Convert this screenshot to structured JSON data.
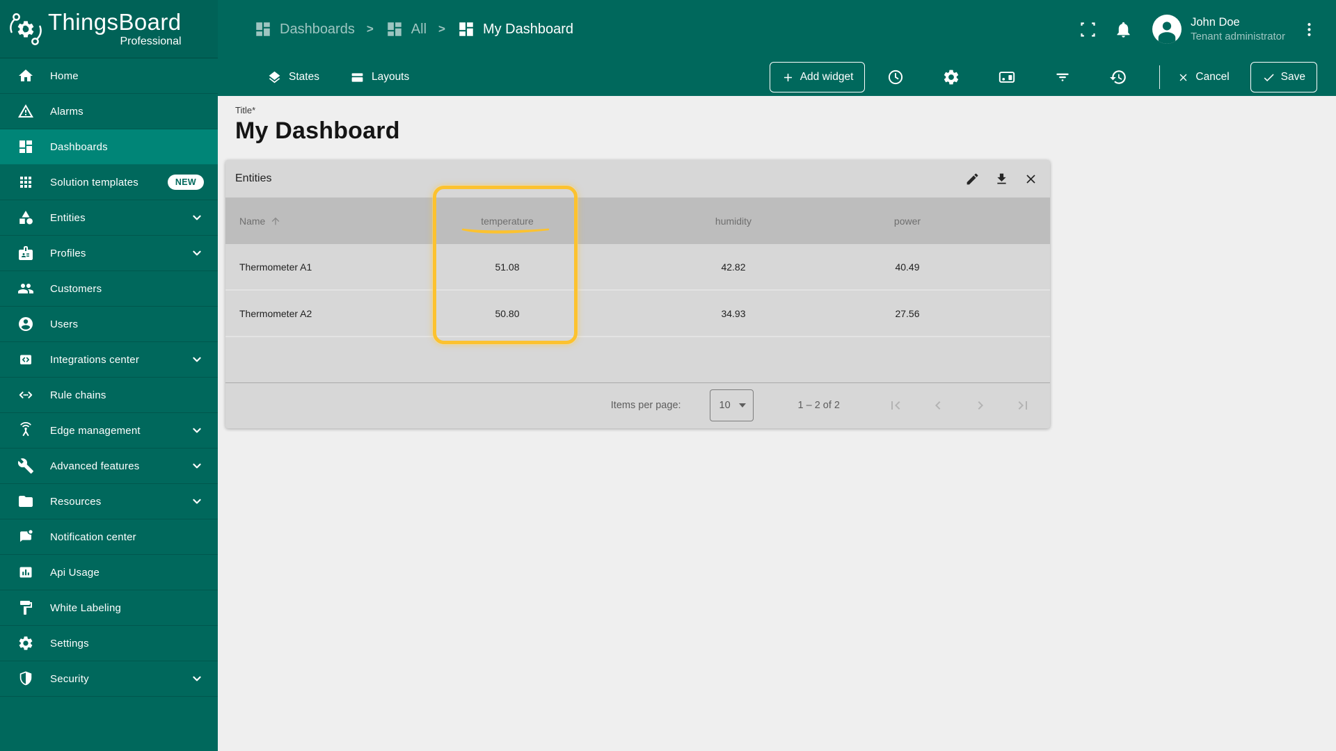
{
  "app": {
    "name": "ThingsBoard",
    "edition": "Professional"
  },
  "colors": {
    "primary": "#00685c",
    "primary_selected": "#008577",
    "highlight": "#fcc22f",
    "content_bg": "#efefef",
    "widget_bg": "#d7d7d7",
    "table_header_bg": "#bdbdbd"
  },
  "breadcrumb": {
    "separator": ">",
    "items": [
      {
        "label": "Dashboards",
        "icon": "dashboards-icon"
      },
      {
        "label": "All",
        "icon": "dashboards-icon"
      },
      {
        "label": "My Dashboard",
        "icon": "dashboards-icon"
      }
    ]
  },
  "user": {
    "name": "John Doe",
    "role": "Tenant administrator"
  },
  "sidebar": {
    "items": [
      {
        "label": "Home",
        "icon": "home-icon"
      },
      {
        "label": "Alarms",
        "icon": "warning-icon"
      },
      {
        "label": "Dashboards",
        "icon": "dashboards-icon",
        "selected": true
      },
      {
        "label": "Solution templates",
        "icon": "apps-grid-icon",
        "badge": "NEW"
      },
      {
        "label": "Entities",
        "icon": "category-icon",
        "expandable": true
      },
      {
        "label": "Profiles",
        "icon": "badge-icon",
        "expandable": true
      },
      {
        "label": "Customers",
        "icon": "people-icon"
      },
      {
        "label": "Users",
        "icon": "person-circle-icon"
      },
      {
        "label": "Integrations center",
        "icon": "integration-icon",
        "expandable": true
      },
      {
        "label": "Rule chains",
        "icon": "rule-chain-icon"
      },
      {
        "label": "Edge management",
        "icon": "antenna-icon",
        "expandable": true
      },
      {
        "label": "Advanced features",
        "icon": "wrench-icon",
        "expandable": true
      },
      {
        "label": "Resources",
        "icon": "folder-icon",
        "expandable": true
      },
      {
        "label": "Notification center",
        "icon": "chat-unread-icon"
      },
      {
        "label": "Api Usage",
        "icon": "bar-chart-icon"
      },
      {
        "label": "White Labeling",
        "icon": "paint-roller-icon"
      },
      {
        "label": "Settings",
        "icon": "gear-icon"
      },
      {
        "label": "Security",
        "icon": "shield-icon",
        "expandable": true
      }
    ]
  },
  "toolbar": {
    "states": "States",
    "layouts": "Layouts",
    "add_widget": "Add widget",
    "cancel": "Cancel",
    "save": "Save"
  },
  "page": {
    "title_label": "Title*",
    "title_value": "My Dashboard"
  },
  "widget": {
    "title": "Entities",
    "table": {
      "columns": [
        "Name",
        "temperature",
        "humidity",
        "power"
      ],
      "rows": [
        {
          "name": "Thermometer A1",
          "values": [
            "51.08",
            "42.82",
            "40.49"
          ]
        },
        {
          "name": "Thermometer A2",
          "values": [
            "50.80",
            "34.93",
            "27.56"
          ]
        }
      ]
    },
    "pagination": {
      "items_per_page_label": "Items per page:",
      "page_size": "10",
      "range": "1 – 2 of 2"
    }
  }
}
